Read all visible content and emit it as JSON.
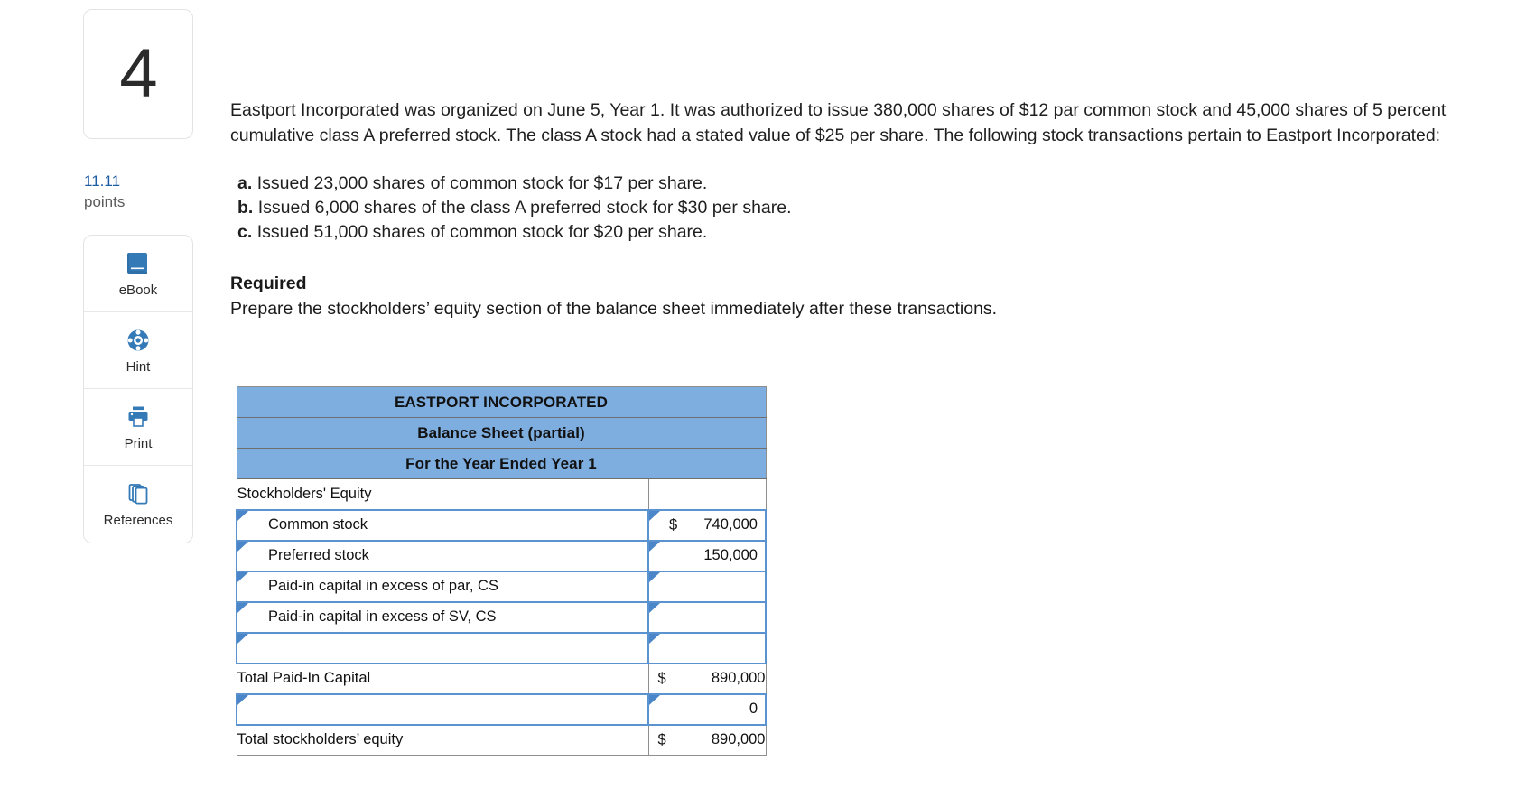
{
  "question": {
    "number": "4",
    "points_value": "11.11",
    "points_label": "points"
  },
  "tools": [
    {
      "label": "eBook",
      "icon": "ebook-icon"
    },
    {
      "label": "Hint",
      "icon": "lifering-icon"
    },
    {
      "label": "Print",
      "icon": "printer-icon"
    },
    {
      "label": "References",
      "icon": "copy-pages-icon"
    }
  ],
  "body": {
    "intro": "Eastport Incorporated was organized on June 5, Year 1. It was authorized to issue 380,000 shares of $12 par common stock and 45,000 shares of 5 percent cumulative class A preferred stock. The class A stock had a stated value of $25 per share. The following stock transactions pertain to Eastport Incorporated:",
    "transactions": [
      {
        "marker": "a.",
        "text": "Issued 23,000 shares of common stock for $17 per share."
      },
      {
        "marker": "b.",
        "text": "Issued 6,000 shares of the class A preferred stock for $30 per share."
      },
      {
        "marker": "c.",
        "text": "Issued 51,000 shares of common stock for $20 per share."
      }
    ],
    "required_heading": "Required",
    "required_text": "Prepare the stockholders’ equity section of the balance sheet immediately after these transactions."
  },
  "sheet": {
    "header_color": "#7eaddf",
    "accent_color": "#5b92d0",
    "titles": [
      "EASTPORT INCORPORATED",
      "Balance Sheet (partial)",
      "For the Year Ended Year 1"
    ],
    "rows": [
      {
        "label": "Stockholders' Equity",
        "value": "",
        "dollar": "",
        "editable_label": false,
        "editable_value": false,
        "indent": 0
      },
      {
        "label": "Common stock",
        "value": "740,000",
        "dollar": "$",
        "editable_label": true,
        "editable_value": true,
        "indent": 1
      },
      {
        "label": "Preferred stock",
        "value": "150,000",
        "dollar": "",
        "editable_label": true,
        "editable_value": true,
        "indent": 1
      },
      {
        "label": "Paid-in capital in excess of par, CS",
        "value": "",
        "dollar": "",
        "editable_label": true,
        "editable_value": true,
        "indent": 1
      },
      {
        "label": "Paid-in capital in excess of SV, CS",
        "value": "",
        "dollar": "",
        "editable_label": true,
        "editable_value": true,
        "indent": 1
      },
      {
        "label": "",
        "value": "",
        "dollar": "",
        "editable_label": true,
        "editable_value": true,
        "indent": 1
      },
      {
        "label": "Total Paid-In Capital",
        "value": "890,000",
        "dollar": "$",
        "editable_label": false,
        "editable_value": false,
        "indent": 0,
        "top_rule": true
      },
      {
        "label": "",
        "value": "0",
        "dollar": "",
        "editable_label": true,
        "editable_value": true,
        "indent": 0
      },
      {
        "label": "Total stockholders’ equity",
        "value": "890,000",
        "dollar": "$",
        "editable_label": false,
        "editable_value": false,
        "indent": 0,
        "top_rule": true
      }
    ]
  }
}
